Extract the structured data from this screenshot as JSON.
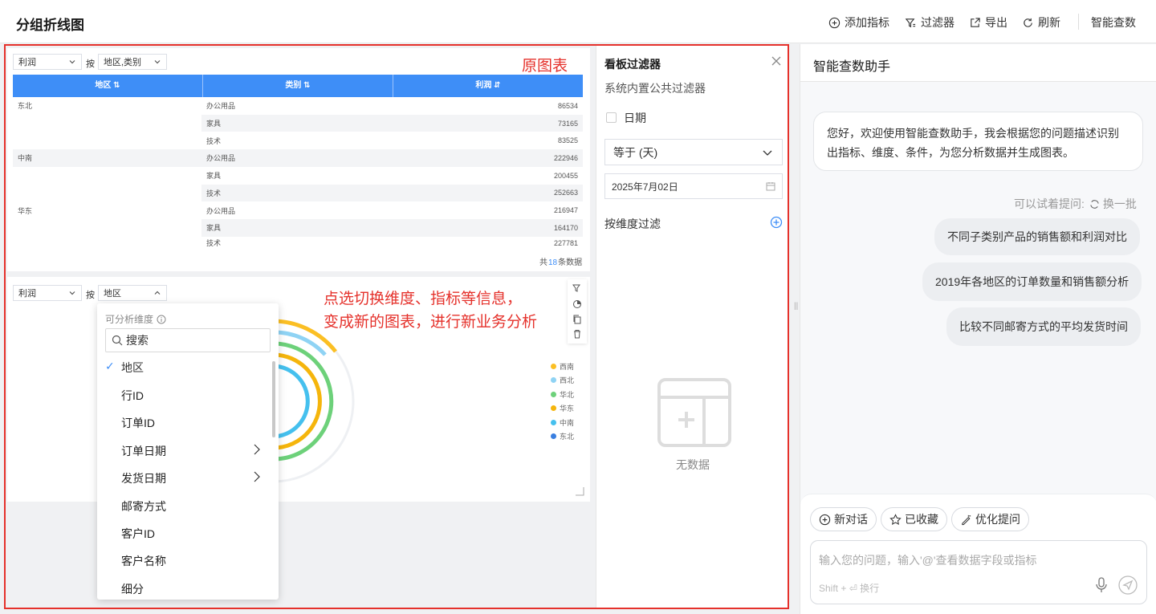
{
  "header": {
    "title": "分组折线图",
    "add_metric": "添加指标",
    "filter": "过滤器",
    "export": "导出",
    "refresh": "刷新",
    "smart_query": "智能查数"
  },
  "annotations": {
    "original_chart": "原图表",
    "note_line1": "点选切换维度、指标等信息，",
    "note_line2": "变成新的图表，进行新业务分析"
  },
  "table_widget": {
    "metric_select": "利润",
    "by_label": "按",
    "dimension_select": "地区,类别",
    "columns": [
      "地区 ⇅",
      "类别 ⇅",
      "利润 ⇵"
    ],
    "rows": [
      {
        "region": "东北",
        "category": "办公用品",
        "profit": "86534"
      },
      {
        "region": "",
        "category": "家具",
        "profit": "73165"
      },
      {
        "region": "",
        "category": "技术",
        "profit": "83525"
      },
      {
        "region": "中南",
        "category": "办公用品",
        "profit": "222946"
      },
      {
        "region": "",
        "category": "家具",
        "profit": "200455"
      },
      {
        "region": "",
        "category": "技术",
        "profit": "252663"
      },
      {
        "region": "华东",
        "category": "办公用品",
        "profit": "216947"
      },
      {
        "region": "",
        "category": "家具",
        "profit": "164170"
      },
      {
        "region": "",
        "category": "技术",
        "profit": "227781"
      }
    ],
    "footer_prefix": "共",
    "footer_count": "18",
    "footer_suffix": "条数据"
  },
  "chart_widget": {
    "metric_select": "利润",
    "by_label": "按",
    "dimension_select": "地区",
    "legend": [
      {
        "label": "西南",
        "color": "#fbbf24"
      },
      {
        "label": "西北",
        "color": "#8fd3f4"
      },
      {
        "label": "华北",
        "color": "#6dd17a"
      },
      {
        "label": "华东",
        "color": "#f5b50c"
      },
      {
        "label": "中南",
        "color": "#45c0ee"
      },
      {
        "label": "东北",
        "color": "#3a7fe0"
      }
    ]
  },
  "dimension_dropdown": {
    "title": "可分析维度",
    "search_placeholder": "搜索",
    "items": [
      "地区",
      "行ID",
      "订单ID",
      "订单日期",
      "发货日期",
      "邮寄方式",
      "客户ID",
      "客户名称",
      "细分"
    ],
    "selected": "地区"
  },
  "filter_panel": {
    "title": "看板过滤器",
    "subtitle": "系统内置公共过滤器",
    "date_label": "日期",
    "operator": "等于 (天)",
    "date_value": "2025年7月02日",
    "dimension_filter": "按维度过滤",
    "empty": "无数据"
  },
  "assistant": {
    "title": "智能查数助手",
    "greeting_line1": "您好，欢迎使用智能查数助手，我会根据您的问题描述识别",
    "greeting_line2": "出指标、维度、条件，为您分析数据并生成图表。",
    "try_ask": "可以试着提问:",
    "refresh_batch": "换一批",
    "suggestions": [
      "不同子类别产品的销售额和利润对比",
      "2019年各地区的订单数量和销售额分析",
      "比较不同邮寄方式的平均发货时间"
    ],
    "new_chat": "新对话",
    "favorites": "已收藏",
    "optimize": "优化提问",
    "input_placeholder": "输入您的问题，输入'@'查看数据字段或指标",
    "input_hint": "Shift + ⏎ 换行"
  }
}
